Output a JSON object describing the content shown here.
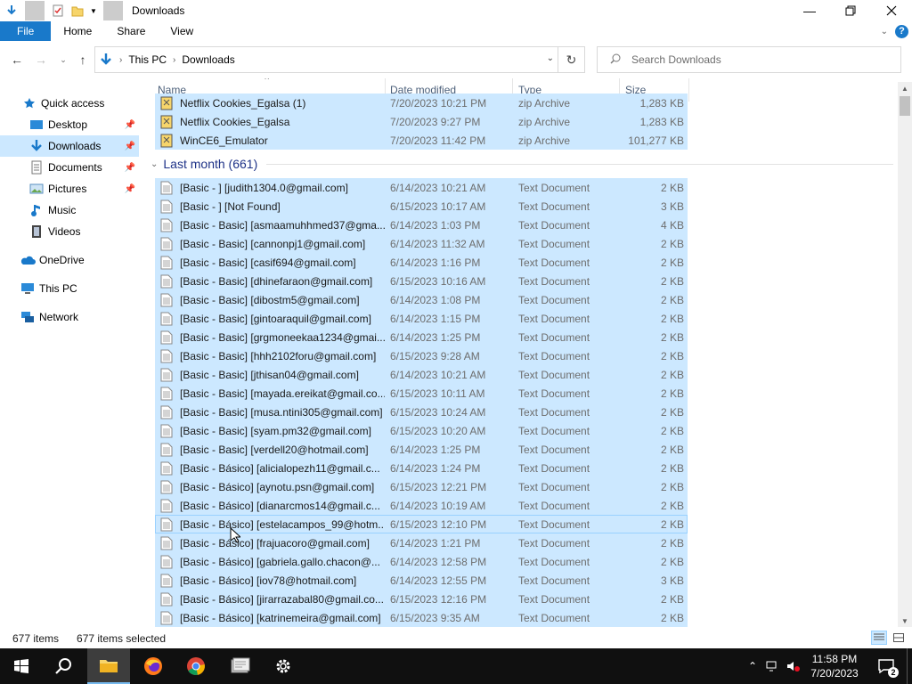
{
  "window": {
    "title": "Downloads"
  },
  "ribbon": {
    "tabs": [
      "File",
      "Home",
      "Share",
      "View"
    ]
  },
  "address": {
    "crumbs": [
      "This PC",
      "Downloads"
    ]
  },
  "search": {
    "placeholder": "Search Downloads"
  },
  "nav": {
    "items": [
      {
        "label": "Quick access",
        "icon": "star-icon"
      },
      {
        "label": "Desktop",
        "icon": "desktop-icon",
        "pinned": true
      },
      {
        "label": "Downloads",
        "icon": "download-arrow-icon",
        "pinned": true,
        "selected": true
      },
      {
        "label": "Documents",
        "icon": "documents-icon",
        "pinned": true
      },
      {
        "label": "Pictures",
        "icon": "pictures-icon",
        "pinned": true
      },
      {
        "label": "Music",
        "icon": "music-icon"
      },
      {
        "label": "Videos",
        "icon": "videos-icon"
      },
      {
        "label": "OneDrive",
        "icon": "cloud-icon"
      },
      {
        "label": "This PC",
        "icon": "computer-icon"
      },
      {
        "label": "Network",
        "icon": "network-icon"
      }
    ]
  },
  "columns": {
    "name": "Name",
    "date": "Date modified",
    "type": "Type",
    "size": "Size"
  },
  "top_files": [
    {
      "name": "Netflix Cookies_Egalsa (1)",
      "date": "7/20/2023 10:21 PM",
      "type": "zip Archive",
      "size": "1,283 KB"
    },
    {
      "name": "Netflix Cookies_Egalsa",
      "date": "7/20/2023 9:27 PM",
      "type": "zip Archive",
      "size": "1,283 KB"
    },
    {
      "name": "WinCE6_Emulator",
      "date": "7/20/2023 11:42 PM",
      "type": "zip Archive",
      "size": "101,277 KB"
    }
  ],
  "group": {
    "label": "Last month (661)"
  },
  "files": [
    {
      "name": "[Basic - ] [judith1304.0@gmail.com]",
      "date": "6/14/2023 10:21 AM",
      "type": "Text Document",
      "size": "2 KB"
    },
    {
      "name": "[Basic - ] [Not Found]",
      "date": "6/15/2023 10:17 AM",
      "type": "Text Document",
      "size": "3 KB"
    },
    {
      "name": "[Basic - Basic] [asmaamuhhmed37@gma...",
      "date": "6/14/2023 1:03 PM",
      "type": "Text Document",
      "size": "4 KB"
    },
    {
      "name": "[Basic - Basic] [cannonpj1@gmail.com]",
      "date": "6/14/2023 11:32 AM",
      "type": "Text Document",
      "size": "2 KB"
    },
    {
      "name": "[Basic - Basic] [casif694@gmail.com]",
      "date": "6/14/2023 1:16 PM",
      "type": "Text Document",
      "size": "2 KB"
    },
    {
      "name": "[Basic - Basic] [dhinefaraon@gmail.com]",
      "date": "6/15/2023 10:16 AM",
      "type": "Text Document",
      "size": "2 KB"
    },
    {
      "name": "[Basic - Basic] [dibostm5@gmail.com]",
      "date": "6/14/2023 1:08 PM",
      "type": "Text Document",
      "size": "2 KB"
    },
    {
      "name": "[Basic - Basic] [gintoaraquil@gmail.com]",
      "date": "6/14/2023 1:15 PM",
      "type": "Text Document",
      "size": "2 KB"
    },
    {
      "name": "[Basic - Basic] [grgmoneekaa1234@gmai...",
      "date": "6/14/2023 1:25 PM",
      "type": "Text Document",
      "size": "2 KB"
    },
    {
      "name": "[Basic - Basic] [hhh2102foru@gmail.com]",
      "date": "6/15/2023 9:28 AM",
      "type": "Text Document",
      "size": "2 KB"
    },
    {
      "name": "[Basic - Basic] [jthisan04@gmail.com]",
      "date": "6/14/2023 10:21 AM",
      "type": "Text Document",
      "size": "2 KB"
    },
    {
      "name": "[Basic - Basic] [mayada.ereikat@gmail.co...",
      "date": "6/15/2023 10:11 AM",
      "type": "Text Document",
      "size": "2 KB"
    },
    {
      "name": "[Basic - Basic] [musa.ntini305@gmail.com]",
      "date": "6/15/2023 10:24 AM",
      "type": "Text Document",
      "size": "2 KB"
    },
    {
      "name": "[Basic - Basic] [syam.pm32@gmail.com]",
      "date": "6/15/2023 10:20 AM",
      "type": "Text Document",
      "size": "2 KB"
    },
    {
      "name": "[Basic - Basic] [verdell20@hotmail.com]",
      "date": "6/14/2023 1:25 PM",
      "type": "Text Document",
      "size": "2 KB"
    },
    {
      "name": "[Basic - Básico] [alicialopezh11@gmail.c...",
      "date": "6/14/2023 1:24 PM",
      "type": "Text Document",
      "size": "2 KB"
    },
    {
      "name": "[Basic - Básico] [aynotu.psn@gmail.com]",
      "date": "6/15/2023 12:21 PM",
      "type": "Text Document",
      "size": "2 KB"
    },
    {
      "name": "[Basic - Básico] [dianarcmos14@gmail.c...",
      "date": "6/14/2023 10:19 AM",
      "type": "Text Document",
      "size": "2 KB"
    },
    {
      "name": "[Basic - Básico] [estelacampos_99@hotm...",
      "date": "6/15/2023 12:10 PM",
      "type": "Text Document",
      "size": "2 KB"
    },
    {
      "name": "[Basic - Básico] [frajuacoro@gmail.com]",
      "date": "6/14/2023 1:21 PM",
      "type": "Text Document",
      "size": "2 KB"
    },
    {
      "name": "[Basic - Básico] [gabriela.gallo.chacon@...",
      "date": "6/14/2023 12:58 PM",
      "type": "Text Document",
      "size": "2 KB"
    },
    {
      "name": "[Basic - Básico] [iov78@hotmail.com]",
      "date": "6/14/2023 12:55 PM",
      "type": "Text Document",
      "size": "3 KB"
    },
    {
      "name": "[Basic - Básico] [jirarrazabal80@gmail.co...",
      "date": "6/15/2023 12:16 PM",
      "type": "Text Document",
      "size": "2 KB"
    },
    {
      "name": "[Basic - Básico] [katrinemeira@gmail.com]",
      "date": "6/15/2023 9:35 AM",
      "type": "Text Document",
      "size": "2 KB"
    }
  ],
  "status": {
    "count": "677 items",
    "selected": "677 items selected"
  },
  "taskbar": {
    "time": "11:58 PM",
    "date": "7/20/2023",
    "apps": [
      "start-icon",
      "search-icon",
      "file-explorer-icon",
      "firefox-icon",
      "chrome-icon",
      "app-window-icon",
      "settings-icon"
    ]
  },
  "colors": {
    "accent": "#1979ca",
    "selection": "#cce8ff",
    "group_header": "#1e3287"
  }
}
